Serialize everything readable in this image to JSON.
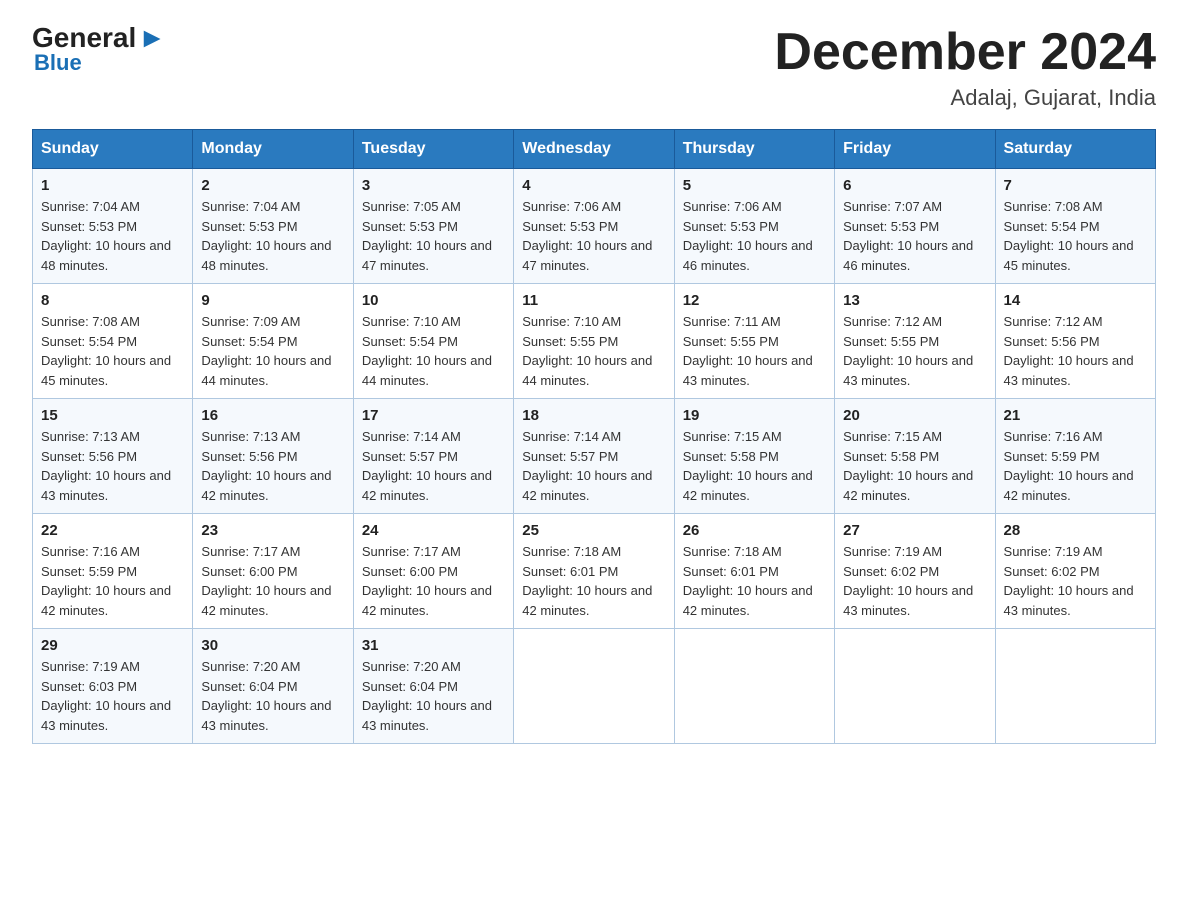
{
  "header": {
    "logo": {
      "general": "General",
      "blue": "Blue",
      "arrow": "▶"
    },
    "title": "December 2024",
    "location": "Adalaj, Gujarat, India"
  },
  "weekdays": [
    "Sunday",
    "Monday",
    "Tuesday",
    "Wednesday",
    "Thursday",
    "Friday",
    "Saturday"
  ],
  "weeks": [
    [
      {
        "day": "1",
        "sunrise": "7:04 AM",
        "sunset": "5:53 PM",
        "daylight": "10 hours and 48 minutes."
      },
      {
        "day": "2",
        "sunrise": "7:04 AM",
        "sunset": "5:53 PM",
        "daylight": "10 hours and 48 minutes."
      },
      {
        "day": "3",
        "sunrise": "7:05 AM",
        "sunset": "5:53 PM",
        "daylight": "10 hours and 47 minutes."
      },
      {
        "day": "4",
        "sunrise": "7:06 AM",
        "sunset": "5:53 PM",
        "daylight": "10 hours and 47 minutes."
      },
      {
        "day": "5",
        "sunrise": "7:06 AM",
        "sunset": "5:53 PM",
        "daylight": "10 hours and 46 minutes."
      },
      {
        "day": "6",
        "sunrise": "7:07 AM",
        "sunset": "5:53 PM",
        "daylight": "10 hours and 46 minutes."
      },
      {
        "day": "7",
        "sunrise": "7:08 AM",
        "sunset": "5:54 PM",
        "daylight": "10 hours and 45 minutes."
      }
    ],
    [
      {
        "day": "8",
        "sunrise": "7:08 AM",
        "sunset": "5:54 PM",
        "daylight": "10 hours and 45 minutes."
      },
      {
        "day": "9",
        "sunrise": "7:09 AM",
        "sunset": "5:54 PM",
        "daylight": "10 hours and 44 minutes."
      },
      {
        "day": "10",
        "sunrise": "7:10 AM",
        "sunset": "5:54 PM",
        "daylight": "10 hours and 44 minutes."
      },
      {
        "day": "11",
        "sunrise": "7:10 AM",
        "sunset": "5:55 PM",
        "daylight": "10 hours and 44 minutes."
      },
      {
        "day": "12",
        "sunrise": "7:11 AM",
        "sunset": "5:55 PM",
        "daylight": "10 hours and 43 minutes."
      },
      {
        "day": "13",
        "sunrise": "7:12 AM",
        "sunset": "5:55 PM",
        "daylight": "10 hours and 43 minutes."
      },
      {
        "day": "14",
        "sunrise": "7:12 AM",
        "sunset": "5:56 PM",
        "daylight": "10 hours and 43 minutes."
      }
    ],
    [
      {
        "day": "15",
        "sunrise": "7:13 AM",
        "sunset": "5:56 PM",
        "daylight": "10 hours and 43 minutes."
      },
      {
        "day": "16",
        "sunrise": "7:13 AM",
        "sunset": "5:56 PM",
        "daylight": "10 hours and 42 minutes."
      },
      {
        "day": "17",
        "sunrise": "7:14 AM",
        "sunset": "5:57 PM",
        "daylight": "10 hours and 42 minutes."
      },
      {
        "day": "18",
        "sunrise": "7:14 AM",
        "sunset": "5:57 PM",
        "daylight": "10 hours and 42 minutes."
      },
      {
        "day": "19",
        "sunrise": "7:15 AM",
        "sunset": "5:58 PM",
        "daylight": "10 hours and 42 minutes."
      },
      {
        "day": "20",
        "sunrise": "7:15 AM",
        "sunset": "5:58 PM",
        "daylight": "10 hours and 42 minutes."
      },
      {
        "day": "21",
        "sunrise": "7:16 AM",
        "sunset": "5:59 PM",
        "daylight": "10 hours and 42 minutes."
      }
    ],
    [
      {
        "day": "22",
        "sunrise": "7:16 AM",
        "sunset": "5:59 PM",
        "daylight": "10 hours and 42 minutes."
      },
      {
        "day": "23",
        "sunrise": "7:17 AM",
        "sunset": "6:00 PM",
        "daylight": "10 hours and 42 minutes."
      },
      {
        "day": "24",
        "sunrise": "7:17 AM",
        "sunset": "6:00 PM",
        "daylight": "10 hours and 42 minutes."
      },
      {
        "day": "25",
        "sunrise": "7:18 AM",
        "sunset": "6:01 PM",
        "daylight": "10 hours and 42 minutes."
      },
      {
        "day": "26",
        "sunrise": "7:18 AM",
        "sunset": "6:01 PM",
        "daylight": "10 hours and 42 minutes."
      },
      {
        "day": "27",
        "sunrise": "7:19 AM",
        "sunset": "6:02 PM",
        "daylight": "10 hours and 43 minutes."
      },
      {
        "day": "28",
        "sunrise": "7:19 AM",
        "sunset": "6:02 PM",
        "daylight": "10 hours and 43 minutes."
      }
    ],
    [
      {
        "day": "29",
        "sunrise": "7:19 AM",
        "sunset": "6:03 PM",
        "daylight": "10 hours and 43 minutes."
      },
      {
        "day": "30",
        "sunrise": "7:20 AM",
        "sunset": "6:04 PM",
        "daylight": "10 hours and 43 minutes."
      },
      {
        "day": "31",
        "sunrise": "7:20 AM",
        "sunset": "6:04 PM",
        "daylight": "10 hours and 43 minutes."
      },
      null,
      null,
      null,
      null
    ]
  ]
}
